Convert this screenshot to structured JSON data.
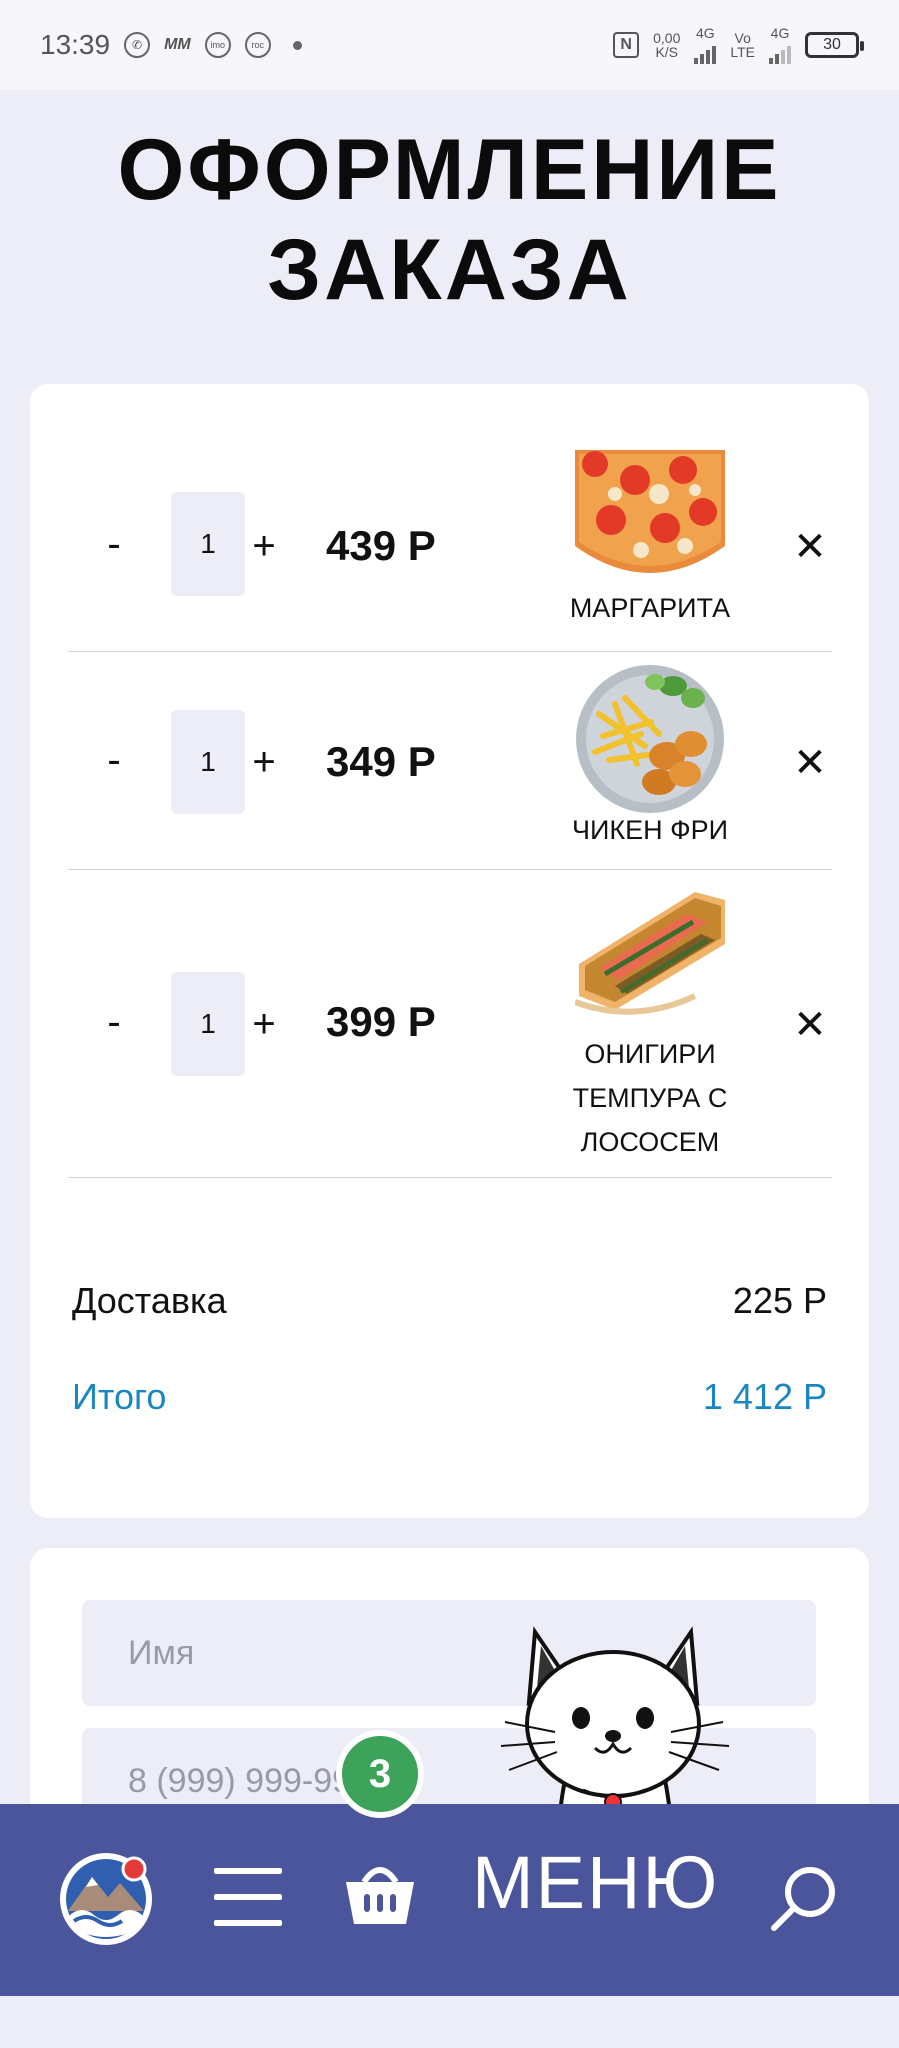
{
  "status_bar": {
    "time": "13:39",
    "app_icons": [
      "whatsapp-icon",
      "mm-icon",
      "imo-icon",
      "gosuslugi-icon"
    ],
    "mm_text": "MM",
    "imo_text": "imo",
    "gos_text": "гос",
    "network_speed": "0,00",
    "network_speed_unit": "K/S",
    "net1": "4G",
    "net2_top": "Vo",
    "net2_bottom": "LTE",
    "net3": "4G",
    "battery": "30",
    "nfc": "N"
  },
  "page": {
    "title_line1": "ОФОРМЛЕНИЕ",
    "title_line2": "ЗАКАЗА"
  },
  "cart": {
    "minus_label": "-",
    "plus_label": "+",
    "remove_label": "✕",
    "items": [
      {
        "qty": "1",
        "price": "439 Р",
        "name": "МАРГАРИТА"
      },
      {
        "qty": "1",
        "price": "349 Р",
        "name": "ЧИКЕН ФРИ"
      },
      {
        "qty": "1",
        "price": "399 Р",
        "name": "ОНИГИРИ ТЕМПУРА С ЛОСОСЕМ"
      }
    ],
    "delivery_label": "Доставка",
    "delivery_value": "225 Р",
    "total_label": "Итого",
    "total_value": "1 412 Р",
    "accent_color": "#1a87c0"
  },
  "form": {
    "name_placeholder": "Имя",
    "phone_placeholder": "8 (999) 999-99-99"
  },
  "bottom_nav": {
    "cart_count": "3",
    "menu_label": "МЕНЮ",
    "background": "#4b559c",
    "badge_color": "#3da25a"
  }
}
